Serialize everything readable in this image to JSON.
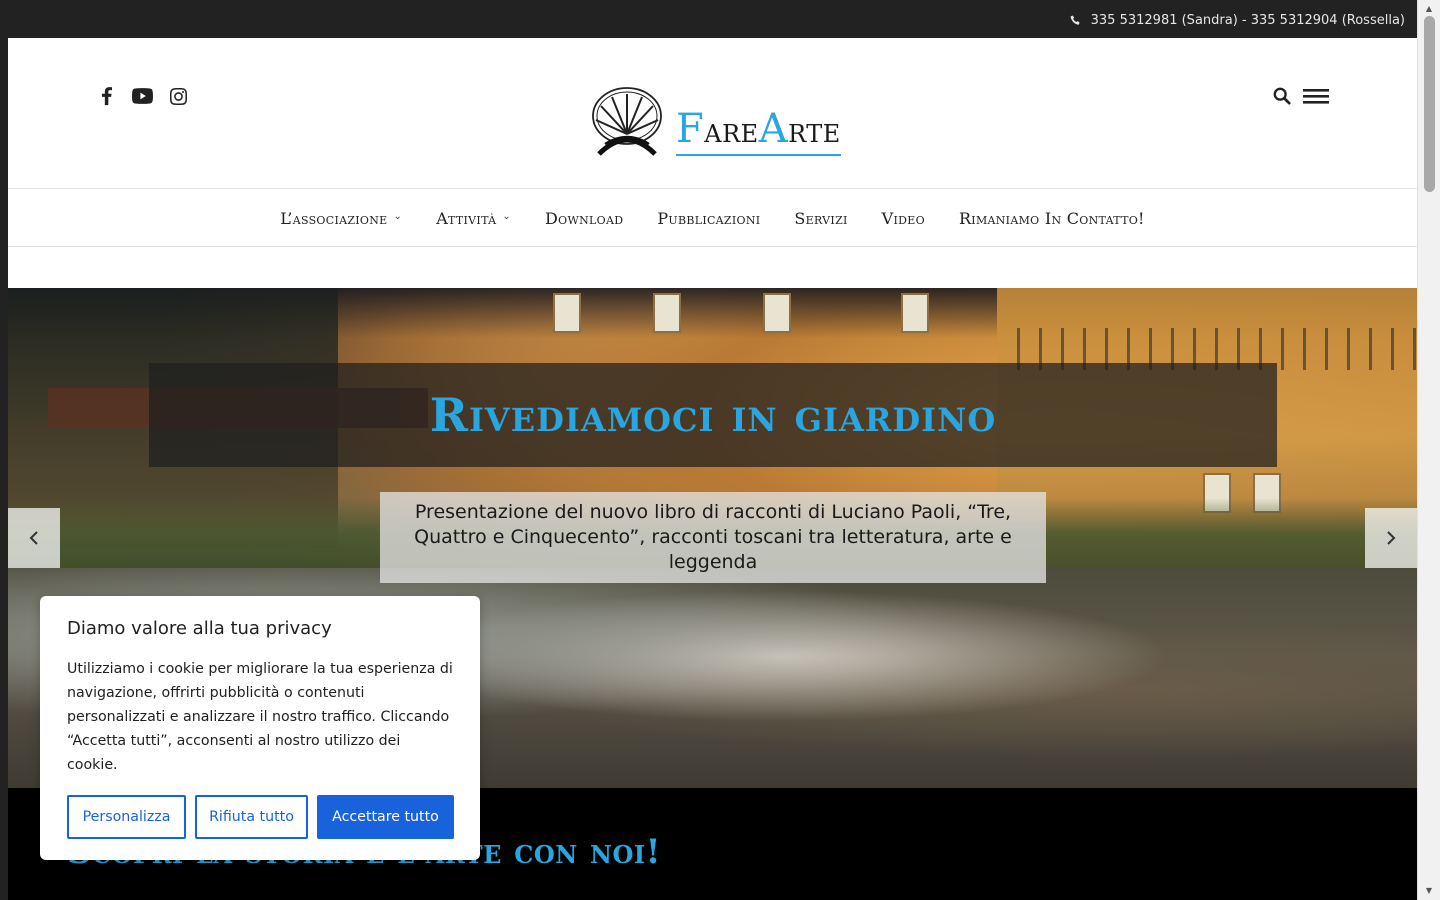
{
  "topbar": {
    "phone_text": "335 5312981 (Sandra) - 335 5312904 (Rossella)"
  },
  "social": [
    "facebook-icon",
    "youtube-icon",
    "instagram-icon"
  ],
  "logo": {
    "part1_initial": "F",
    "part1_rest": "are",
    "part2_initial": "A",
    "part2_rest": "rte"
  },
  "nav": {
    "items": [
      {
        "label": "L’associazione",
        "has_dropdown": true
      },
      {
        "label": "Attività",
        "has_dropdown": true
      },
      {
        "label": "Download",
        "has_dropdown": false
      },
      {
        "label": "Pubblicazioni",
        "has_dropdown": false
      },
      {
        "label": "Servizi",
        "has_dropdown": false
      },
      {
        "label": "Video",
        "has_dropdown": false
      },
      {
        "label": "Rimaniamo In Contatto!",
        "has_dropdown": false
      }
    ],
    "chevron": "⌄"
  },
  "hero": {
    "title": "Rivediamoci in giardino",
    "subtitle": "Presentazione del nuovo libro di racconti di Luciano Paoli, “Tre, Quattro e Cinquecento”, racconti toscani tra letteratura, arte e leggenda"
  },
  "band": {
    "title": "Scopri la storia e l'arte con noi!"
  },
  "cookie": {
    "title": "Diamo valore alla tua privacy",
    "text": "Utilizziamo i cookie per migliorare la tua esperienza di navigazione, offrirti pubblicità o contenuti personalizzati e analizzare il nostro traffico. Cliccando “Accetta tutti”, acconsenti al nostro utilizzo dei cookie.",
    "btn_customize": "Personalizza",
    "btn_reject": "Rifiuta tutto",
    "btn_accept": "Accettare tutto"
  },
  "colors": {
    "accent": "#29a6df",
    "cookie_button": "#1863dc",
    "topbar": "#222222"
  }
}
